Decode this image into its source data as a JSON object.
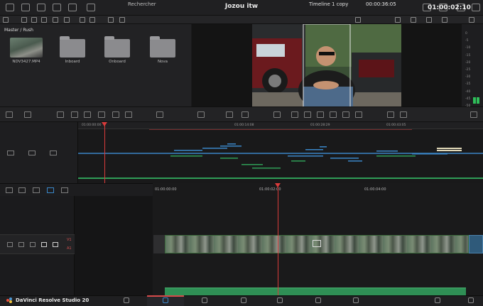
{
  "app": {
    "title": "Jozou itw",
    "brand": "DaVinci Resolve Studio 20"
  },
  "toolbar": {
    "search_label": "Rechercher",
    "timeline_name": "Timeline 1 copy",
    "timecode_top": "00:00:36:05"
  },
  "media_pool": {
    "breadcrumb": "Master / Rush",
    "items": [
      {
        "name": "NDV3427.MP4",
        "kind": "clip"
      },
      {
        "name": "Inboard",
        "kind": "folder"
      },
      {
        "name": "Onboard",
        "kind": "folder"
      },
      {
        "name": "Nova",
        "kind": "folder"
      }
    ]
  },
  "audio_meter": {
    "scale": [
      "0",
      "-5",
      "-10",
      "-15",
      "-20",
      "-25",
      "-30",
      "-35",
      "-40",
      "-45",
      "-50"
    ]
  },
  "transport": {
    "timecode": "01:00:02:10"
  },
  "upper_ruler": {
    "labels": [
      "01:00:00:00",
      "01:00:14:08",
      "01:00:28:29",
      "01:00:43:05"
    ]
  },
  "lower_ruler": {
    "labels": [
      "01:00:00:00",
      "01:00:02:00",
      "01:00:04:00"
    ]
  },
  "tracks": {
    "video": "V1",
    "audio": "A1"
  },
  "colors": {
    "playhead": "#d93b3b",
    "video_clip_border": "#3c6a3c",
    "audio_clip": "#2f8f55",
    "marker_blue": "#3a86c8",
    "marker_green": "#2f9d57",
    "active_tab": "#d54a4a"
  }
}
